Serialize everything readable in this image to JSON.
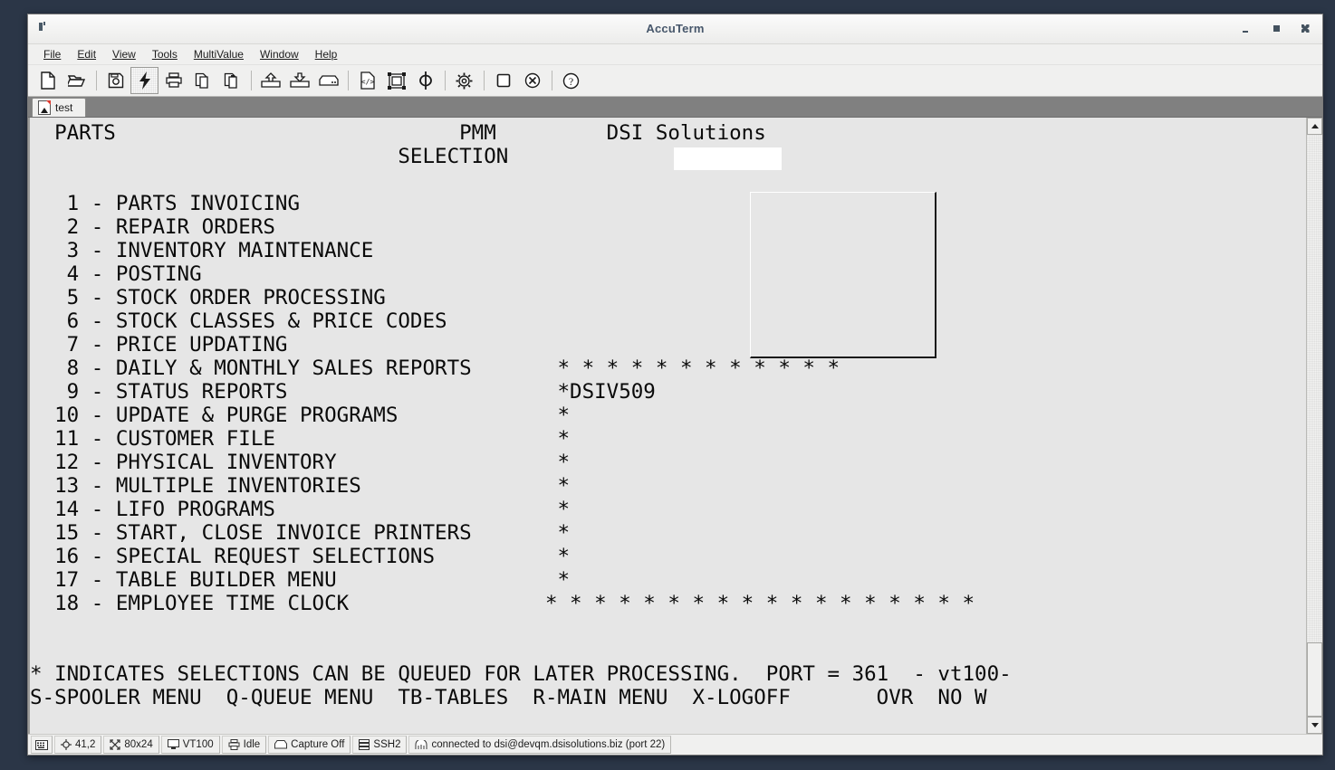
{
  "window": {
    "title": "AccuTerm",
    "icon": "app-icon",
    "controls": {
      "minimize": "minimize",
      "maximize": "maximize",
      "close": "close"
    }
  },
  "menu_bar": {
    "items": [
      {
        "label": "File",
        "accel": "F"
      },
      {
        "label": "Edit",
        "accel": "E"
      },
      {
        "label": "View",
        "accel": "V"
      },
      {
        "label": "Tools",
        "accel": "T"
      },
      {
        "label": "MultiValue",
        "accel": "M"
      },
      {
        "label": "Window",
        "accel": "W"
      },
      {
        "label": "Help",
        "accel": "H"
      }
    ]
  },
  "toolbar": {
    "buttons": [
      {
        "name": "new-file-icon",
        "group": 0
      },
      {
        "name": "open-folder-icon",
        "group": 0
      },
      {
        "name": "save-disk-icon",
        "group": 1
      },
      {
        "name": "lightning-bolt-icon",
        "group": 1,
        "active": true
      },
      {
        "name": "print-icon",
        "group": 1
      },
      {
        "name": "copy-icon",
        "group": 1
      },
      {
        "name": "paste-icon",
        "group": 1
      },
      {
        "name": "upload-icon",
        "group": 2
      },
      {
        "name": "download-icon",
        "group": 2
      },
      {
        "name": "drive-icon",
        "group": 2
      },
      {
        "name": "code-file-icon",
        "group": 3
      },
      {
        "name": "designer-icon",
        "group": 3
      },
      {
        "name": "phi-icon",
        "group": 3
      },
      {
        "name": "gear-icon",
        "group": 4
      },
      {
        "name": "stop-square-icon",
        "group": 5
      },
      {
        "name": "cancel-circle-icon",
        "group": 5
      },
      {
        "name": "help-icon",
        "group": 6
      }
    ]
  },
  "tabs": [
    {
      "label": "test",
      "active": true
    }
  ],
  "terminal": {
    "columns": 80,
    "rows": 24,
    "header": {
      "title": "PARTS",
      "program": "PMM",
      "company": "DSI Solutions",
      "selection_label": "SELECTION",
      "selection_value": ""
    },
    "menu_items": [
      {
        "number": "1",
        "label": "PARTS INVOICING"
      },
      {
        "number": "2",
        "label": "REPAIR ORDERS"
      },
      {
        "number": "3",
        "label": "INVENTORY MAINTENANCE"
      },
      {
        "number": "4",
        "label": "POSTING"
      },
      {
        "number": "5",
        "label": "STOCK ORDER PROCESSING"
      },
      {
        "number": "6",
        "label": "STOCK CLASSES & PRICE CODES"
      },
      {
        "number": "7",
        "label": "PRICE UPDATING"
      },
      {
        "number": "8",
        "label": "DAILY & MONTHLY SALES REPORTS"
      },
      {
        "number": "9",
        "label": "STATUS REPORTS"
      },
      {
        "number": "10",
        "label": "UPDATE & PURGE PROGRAMS"
      },
      {
        "number": "11",
        "label": "CUSTOMER FILE"
      },
      {
        "number": "12",
        "label": "PHYSICAL INVENTORY"
      },
      {
        "number": "13",
        "label": "MULTIPLE INVENTORIES"
      },
      {
        "number": "14",
        "label": "LIFO PROGRAMS"
      },
      {
        "number": "15",
        "label": "START, CLOSE INVOICE PRINTERS"
      },
      {
        "number": "16",
        "label": "SPECIAL REQUEST SELECTIONS"
      },
      {
        "number": "17",
        "label": "TABLE BUILDER MENU"
      },
      {
        "number": "18",
        "label": "EMPLOYEE TIME CLOCK"
      }
    ],
    "lines": [
      "  PARTS                            PMM         DSI Solutions",
      "                              SELECTION",
      "",
      "   1 - PARTS INVOICING",
      "   2 - REPAIR ORDERS",
      "   3 - INVENTORY MAINTENANCE",
      "   4 - POSTING",
      "   5 - STOCK ORDER PROCESSING",
      "   6 - STOCK CLASSES & PRICE CODES",
      "   7 - PRICE UPDATING",
      "   8 - DAILY & MONTHLY SALES REPORTS       * * * * * * * * * * * *",
      "   9 - STATUS REPORTS                      *DSIV509",
      "  10 - UPDATE & PURGE PROGRAMS             *",
      "  11 - CUSTOMER FILE                       *",
      "  12 - PHYSICAL INVENTORY                  *",
      "  13 - MULTIPLE INVENTORIES                *",
      "  14 - LIFO PROGRAMS                       *",
      "  15 - START, CLOSE INVOICE PRINTERS       *",
      "  16 - SPECIAL REQUEST SELECTIONS          *",
      "  17 - TABLE BUILDER MENU                  *",
      "  18 - EMPLOYEE TIME CLOCK                * * * * * * * * * * * * * * * * * *",
      "",
      "",
      "* INDICATES SELECTIONS CAN BE QUEUED FOR LATER PROCESSING.  PORT = 361  - vt100-",
      "S-SPOOLER MENU  Q-QUEUE MENU  TB-TABLES  R-MAIN MENU  X-LOGOFF       OVR  NO W"
    ],
    "overlay_label": "DSIV509",
    "footer_note": "* INDICATES SELECTIONS CAN BE QUEUED FOR LATER PROCESSING.  PORT = 361  - vt100-",
    "footer_commands": "S-SPOOLER MENU  Q-QUEUE MENU  TB-TABLES  R-MAIN MENU  X-LOGOFF       OVR  NO W",
    "port": "361",
    "terminal_type": "vt100-"
  },
  "status_bar": {
    "keyboard_icon": "keyboard-icon",
    "cells": [
      {
        "icon": "cursor-position-icon",
        "label": "41,2"
      },
      {
        "icon": "screen-size-icon",
        "label": "80x24"
      },
      {
        "icon": "monitor-icon",
        "label": "VT100"
      },
      {
        "icon": "printer-icon",
        "label": "Idle"
      },
      {
        "icon": "capture-icon",
        "label": "Capture Off"
      },
      {
        "icon": "server-icon",
        "label": "SSH2"
      },
      {
        "icon": "connection-icon",
        "label": "connected to dsi@devqm.dsisolutions.biz (port 22)"
      }
    ]
  },
  "colors": {
    "desktop": "#2b3647",
    "window_chrome": "#f0f0ef",
    "terminal_bg": "#e6e6e6",
    "terminal_fg": "#0a0a0a",
    "tab_strip": "#808080",
    "title_text": "#47576b"
  }
}
